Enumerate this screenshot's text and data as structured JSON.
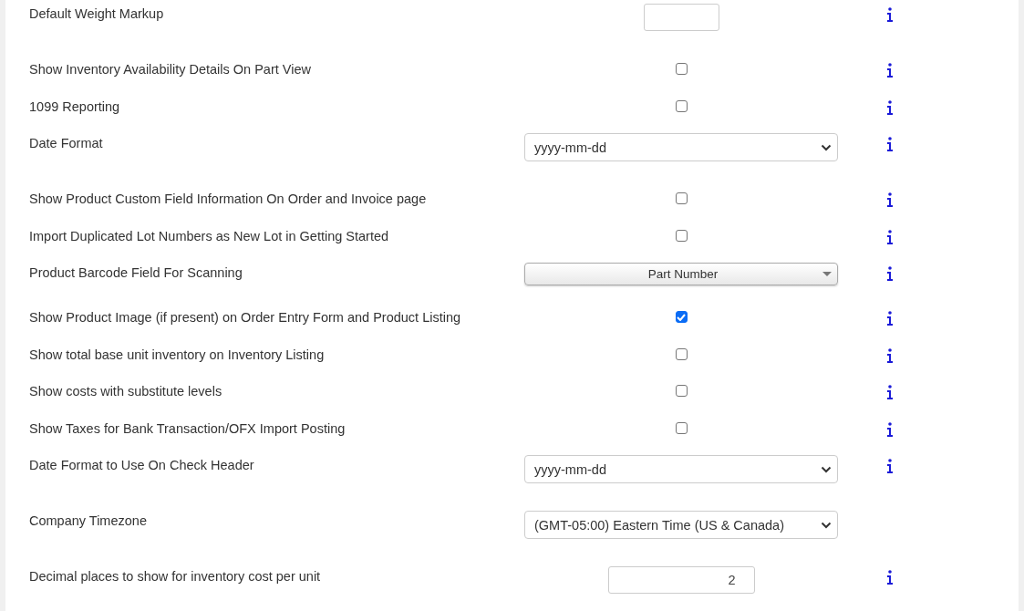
{
  "settings": [
    {
      "label": "Default Weight Markup",
      "kind": "text",
      "info": true
    },
    {
      "label": "Show Inventory Availability Details On Part View",
      "kind": "checkbox",
      "checked": false,
      "info": true
    },
    {
      "label": "1099 Reporting",
      "kind": "checkbox",
      "checked": false,
      "info": true
    },
    {
      "label": "Date Format",
      "kind": "select",
      "value": "yyyy-mm-dd",
      "info": true
    },
    {
      "label": "Show Product Custom Field Information On Order and Invoice page",
      "kind": "checkbox",
      "checked": false,
      "info": true
    },
    {
      "label": "Import Duplicated Lot Numbers as New Lot in Getting Started",
      "kind": "checkbox",
      "checked": false,
      "info": true
    },
    {
      "label": "Product Barcode Field For Scanning",
      "kind": "picker",
      "value": "Part Number",
      "info": true
    },
    {
      "label": "Show Product Image (if present) on Order Entry Form and Product Listing",
      "kind": "checkbox",
      "checked": true,
      "info": true
    },
    {
      "label": "Show total base unit inventory on Inventory Listing",
      "kind": "checkbox",
      "checked": false,
      "info": true
    },
    {
      "label": "Show costs with substitute levels",
      "kind": "checkbox",
      "checked": false,
      "info": true
    },
    {
      "label": "Show Taxes for Bank Transaction/OFX Import Posting",
      "kind": "checkbox",
      "checked": false,
      "info": true
    },
    {
      "label": "Date Format to Use On Check Header",
      "kind": "select",
      "value": "yyyy-mm-dd",
      "info": true
    },
    {
      "label": "Company Timezone",
      "kind": "select",
      "value": "(GMT-05:00) Eastern Time (US & Canada)",
      "info": false
    },
    {
      "label": "Decimal places to show for inventory cost per unit",
      "kind": "number",
      "value": "2",
      "info": true
    }
  ]
}
